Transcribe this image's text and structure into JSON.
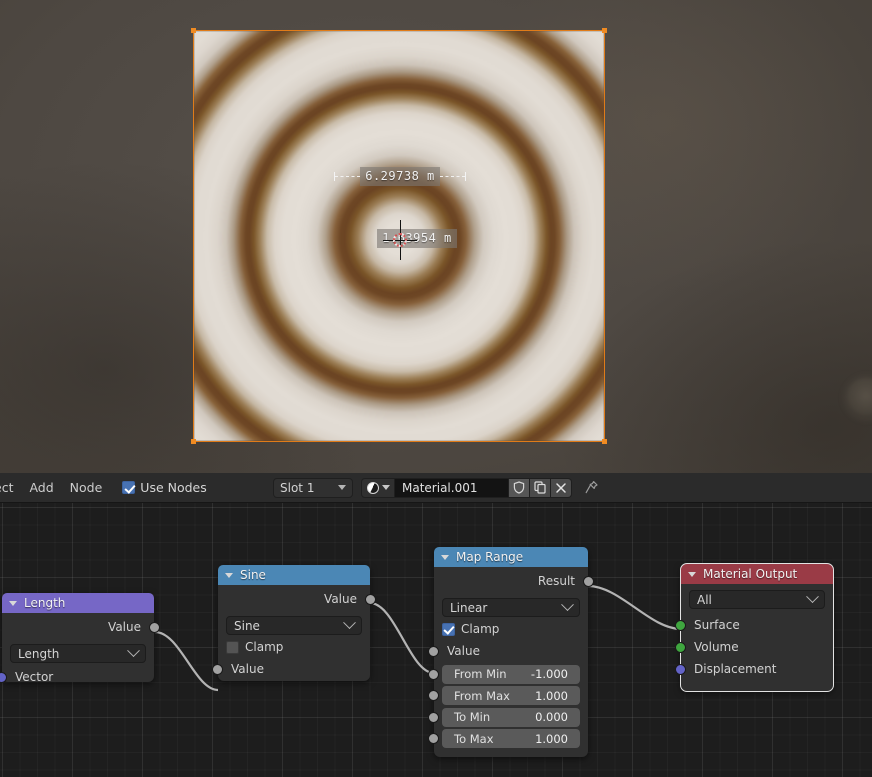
{
  "viewport": {
    "measurements": [
      {
        "name": "width-measure",
        "value": "6.29738 m"
      },
      {
        "name": "cursor-measure",
        "value": "1.63954 m"
      }
    ]
  },
  "editor_header": {
    "menus": [
      {
        "label": "ect",
        "name": "menu-select"
      },
      {
        "label": "Add",
        "name": "menu-add"
      },
      {
        "label": "Node",
        "name": "menu-node"
      }
    ],
    "use_nodes": {
      "label": "Use Nodes",
      "checked": true
    },
    "slot": {
      "value": "Slot 1"
    },
    "material": {
      "name_value": "Material.001",
      "browse_icon": "material-sphere-icon",
      "fake_user_icon": "shield-icon",
      "duplicate_icon": "copy-icon",
      "unlink_icon": "x-icon",
      "pin_icon": "pin-icon"
    }
  },
  "nodes": {
    "length": {
      "title": "Length",
      "header_color": "#7667c6",
      "outputs": [
        {
          "label": "Value",
          "socket": "gray"
        }
      ],
      "dropdown": {
        "value": "Length"
      },
      "inputs": [
        {
          "label": "Vector",
          "socket": "purple"
        }
      ]
    },
    "sine": {
      "title": "Sine",
      "header_color": "#4username",
      "outputs": [
        {
          "label": "Value",
          "socket": "gray"
        }
      ],
      "dropdown": {
        "value": "Sine"
      },
      "clamp": {
        "label": "Clamp",
        "checked": false
      },
      "inputs": [
        {
          "label": "Value",
          "socket": "gray"
        }
      ]
    },
    "map_range": {
      "title": "Map Range",
      "header_color": "#4b87b5",
      "outputs": [
        {
          "label": "Result",
          "socket": "gray"
        }
      ],
      "dropdown": {
        "value": "Linear"
      },
      "clamp": {
        "label": "Clamp",
        "checked": true
      },
      "inputs": [
        {
          "label": "Value",
          "socket": "gray"
        }
      ],
      "fields": [
        {
          "label": "From Min",
          "value": "-1.000"
        },
        {
          "label": "From Max",
          "value": "1.000"
        },
        {
          "label": "To Min",
          "value": "0.000"
        },
        {
          "label": "To Max",
          "value": "1.000"
        }
      ]
    },
    "material_output": {
      "title": "Material Output",
      "header_color": "#9a3b46",
      "dropdown": {
        "value": "All"
      },
      "inputs": [
        {
          "label": "Surface",
          "socket": "green"
        },
        {
          "label": "Volume",
          "socket": "green"
        },
        {
          "label": "Displacement",
          "socket": "purple"
        }
      ]
    }
  }
}
